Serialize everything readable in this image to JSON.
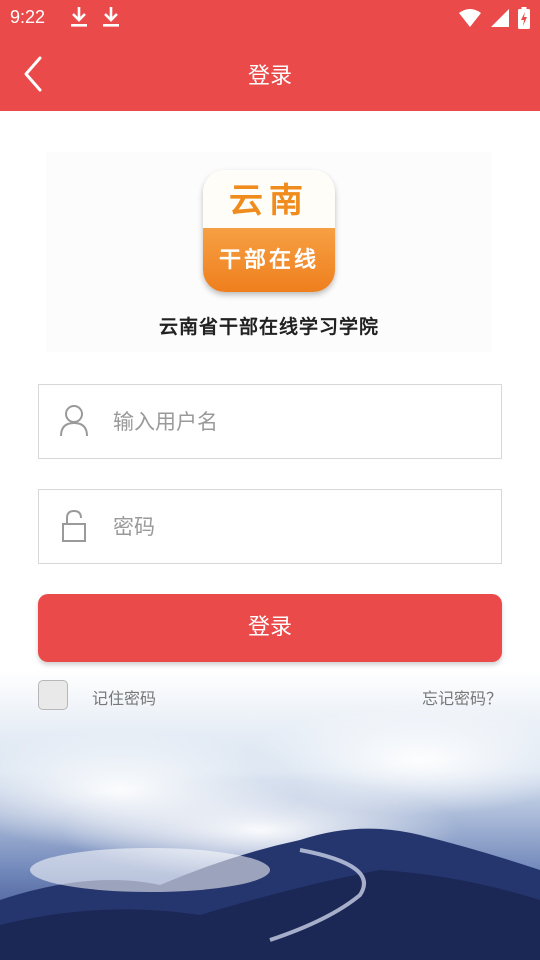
{
  "status_bar": {
    "time": "9:22",
    "icons": [
      "download-icon",
      "download-icon",
      "wifi-icon",
      "signal-icon",
      "battery-icon"
    ]
  },
  "app_bar": {
    "title": "登录",
    "back_icon": "chevron-left-icon"
  },
  "logo": {
    "top_text": "云南",
    "bottom_text": "干部在线",
    "caption": "云南省干部在线学习学院"
  },
  "form": {
    "username": {
      "placeholder": "输入用户名",
      "value": "",
      "icon": "user-icon"
    },
    "password": {
      "placeholder": "密码",
      "value": "",
      "icon": "lock-icon"
    },
    "login_label": "登录",
    "remember_label": "记住密码",
    "remember_checked": false,
    "forgot_label": "忘记密码？"
  },
  "colors": {
    "brand_red": "#eb4a4b",
    "logo_orange": "#ef8c1d",
    "placeholder_gray": "#9a9a9a"
  }
}
